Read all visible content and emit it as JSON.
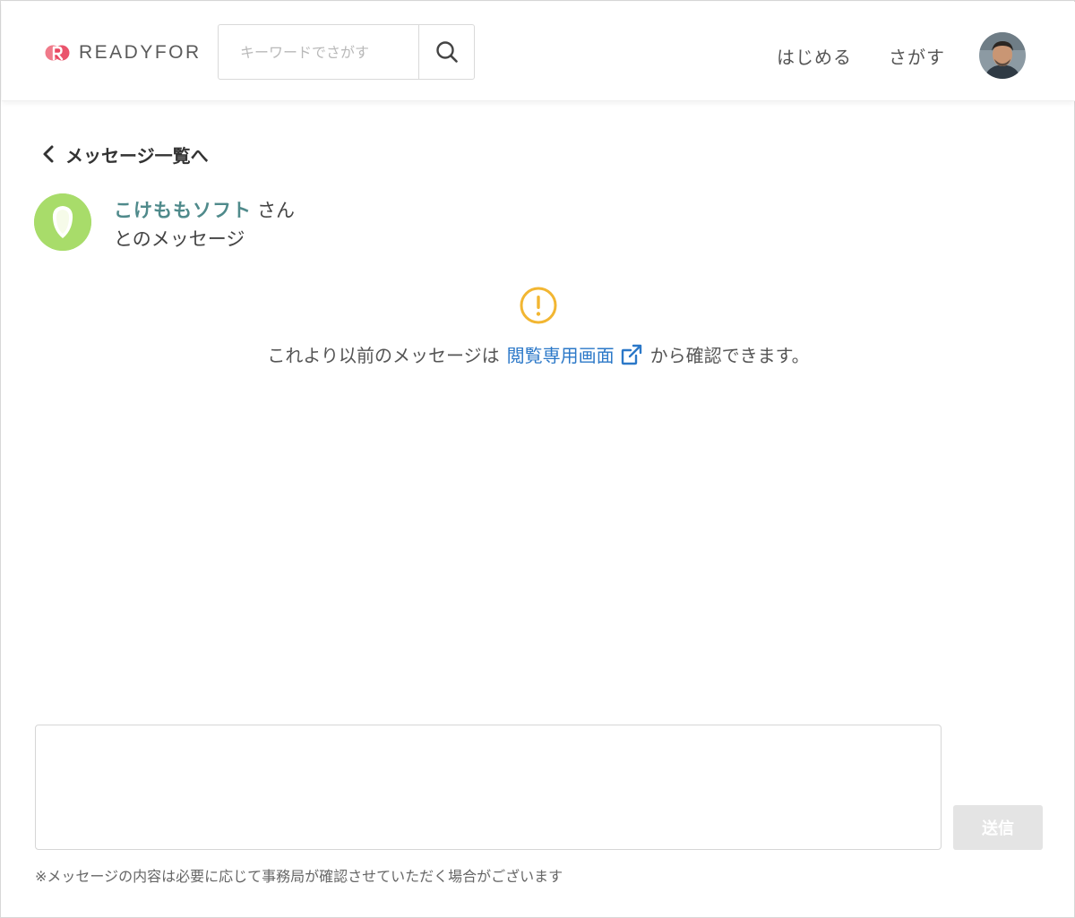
{
  "header": {
    "logo_text": "READYFOR",
    "search": {
      "placeholder": "キーワードでさがす",
      "value": ""
    },
    "nav": {
      "start": "はじめる",
      "find": "さがす"
    }
  },
  "back_link": {
    "label": "メッセージ一覧へ"
  },
  "partner": {
    "name": "こけももソフト",
    "honorific": "さん",
    "subtitle": "とのメッセージ"
  },
  "notice": {
    "before": "これより以前のメッセージは",
    "link": "閲覧専用画面",
    "after": "から確認できます。"
  },
  "compose": {
    "value": "",
    "send_label": "送信",
    "note": "※メッセージの内容は必要に応じて事務局が確認させていただく場合がございます"
  },
  "icons": {
    "logo": "readyfor-logo-mark",
    "search": "search-icon",
    "back": "chevron-left-icon",
    "notice": "exclamation-circle-icon",
    "external": "external-link-icon"
  },
  "colors": {
    "brand": "#e8415c",
    "partner_name": "#4f8a8b",
    "link": "#2b78c8",
    "warning": "#f2b632",
    "partner_avatar": "#a8dc6a",
    "send_disabled": "#e4e4e4"
  }
}
